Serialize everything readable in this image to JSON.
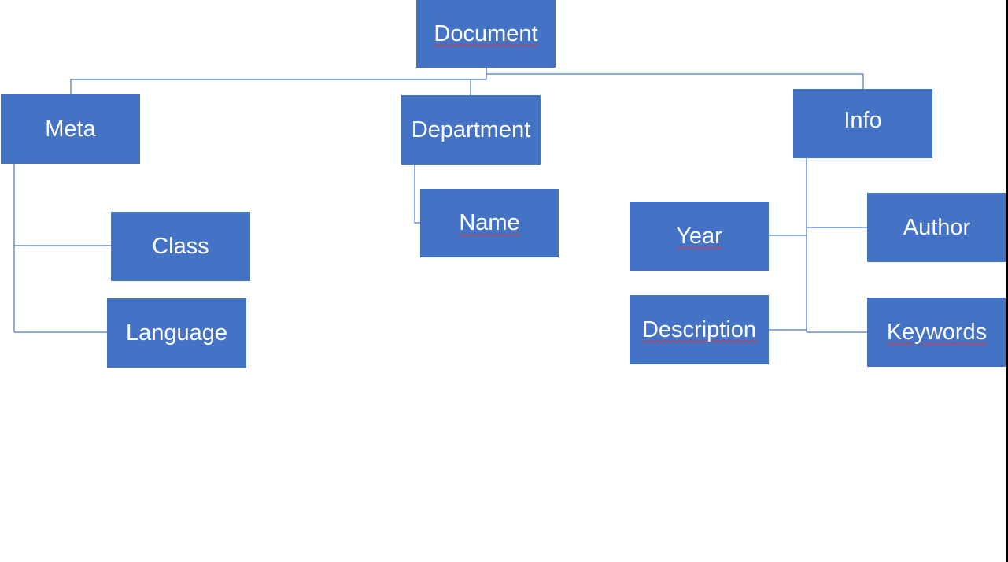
{
  "diagram": {
    "line_color": "#4a74c0",
    "node_color": "#4472c4",
    "text_color": "#ffffff",
    "nodes": {
      "document": "Document",
      "meta": "Meta",
      "department": "Department",
      "info": "Info",
      "class": "Class",
      "language": "Language",
      "name": "Name",
      "year": "Year",
      "description": "Description",
      "author": "Author",
      "keywords": "Keywords"
    },
    "spellcheck_marked": [
      "Document",
      "Name",
      "Year",
      "Description",
      "Keywords"
    ]
  }
}
